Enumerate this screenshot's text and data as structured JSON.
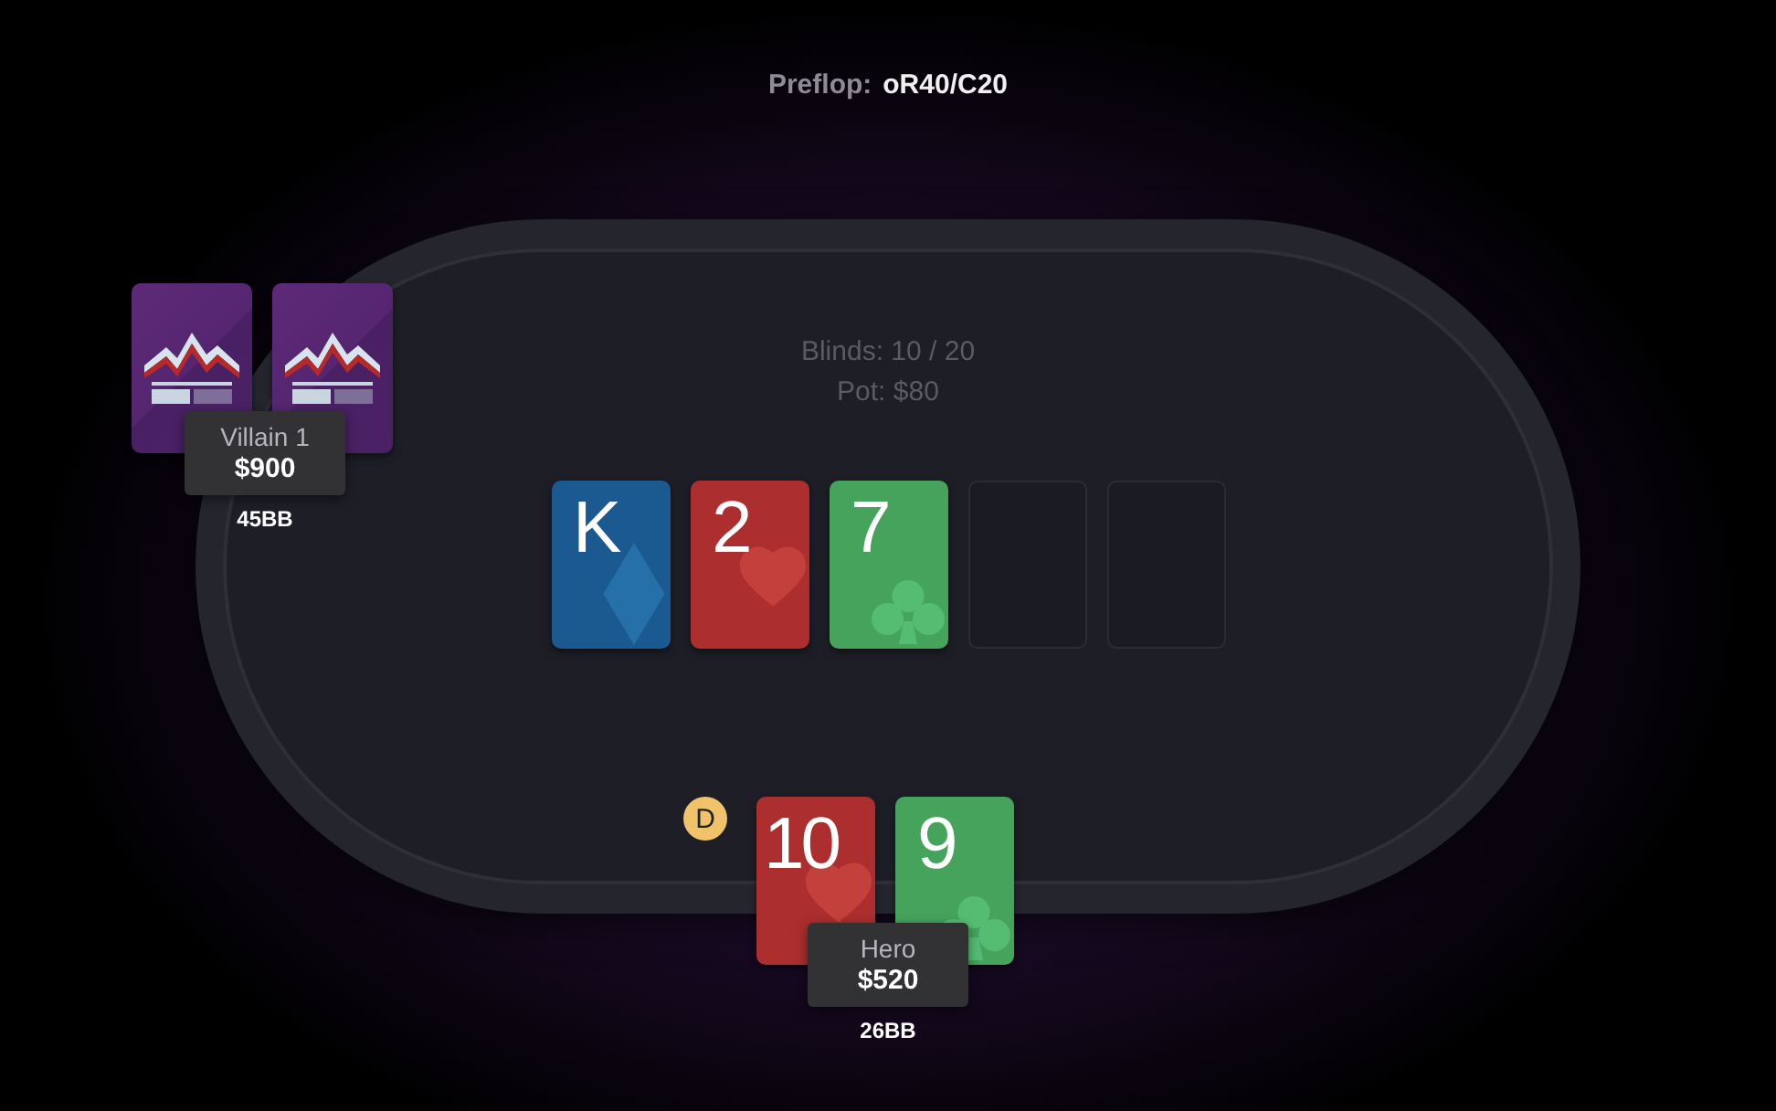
{
  "street": {
    "label": "Preflop:",
    "action": "oR40/C20"
  },
  "table": {
    "blinds": "Blinds: 10 / 20",
    "pot": "Pot: $80"
  },
  "board": [
    {
      "kind": "diamond",
      "rank": "K"
    },
    {
      "kind": "heart",
      "rank": "2"
    },
    {
      "kind": "club",
      "rank": "7"
    },
    {
      "kind": "empty"
    },
    {
      "kind": "empty"
    }
  ],
  "seats": [
    {
      "name": "Villain 1",
      "stack": "$900",
      "bb": "45BB",
      "cards": [
        {
          "kind": "back"
        },
        {
          "kind": "back"
        }
      ]
    },
    {
      "name": "Hero",
      "stack": "$520",
      "bb": "26BB",
      "dealer_button": "D",
      "cards": [
        {
          "kind": "heart",
          "rank": "10"
        },
        {
          "kind": "club",
          "rank": "9"
        }
      ]
    }
  ]
}
